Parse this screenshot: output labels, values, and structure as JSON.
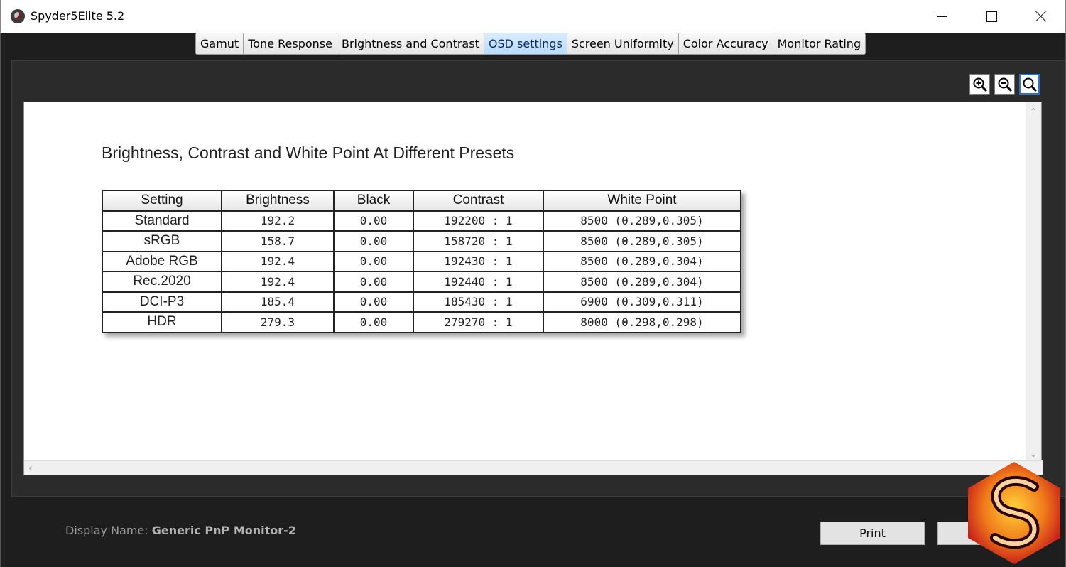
{
  "window": {
    "title": "Spyder5Elite 5.2"
  },
  "tabs": [
    {
      "label": "Gamut"
    },
    {
      "label": "Tone Response"
    },
    {
      "label": "Brightness and Contrast"
    },
    {
      "label": "OSD settings",
      "active": true
    },
    {
      "label": "Screen Uniformity"
    },
    {
      "label": "Color Accuracy"
    },
    {
      "label": "Monitor Rating"
    }
  ],
  "zoom": {
    "icons": [
      "zoom-in-icon",
      "zoom-out-icon",
      "zoom-fit-icon"
    ]
  },
  "report": {
    "title": "Brightness, Contrast and White Point At Different Presets",
    "table": {
      "headers": [
        "Setting",
        "Brightness",
        "Black",
        "Contrast",
        "White Point"
      ],
      "rows": [
        [
          "Standard",
          "192.2",
          "0.00",
          "192200 : 1",
          "8500 (0.289,0.305)"
        ],
        [
          "sRGB",
          "158.7",
          "0.00",
          "158720 : 1",
          "8500 (0.289,0.305)"
        ],
        [
          "Adobe RGB",
          "192.4",
          "0.00",
          "192430 : 1",
          "8500 (0.289,0.304)"
        ],
        [
          "Rec.2020",
          "192.4",
          "0.00",
          "192440 : 1",
          "8500 (0.289,0.304)"
        ],
        [
          "DCI-P3",
          "185.4",
          "0.00",
          "185430 : 1",
          "6900 (0.309,0.311)"
        ],
        [
          "HDR",
          "279.3",
          "0.00",
          "279270 : 1",
          "8000 (0.298,0.298)"
        ]
      ]
    }
  },
  "footer": {
    "display_label": "Display Name:",
    "display_value": "Generic PnP Monitor-2",
    "print_label": "Print"
  },
  "colors": {
    "active_tab": "#b9dbff",
    "background": "#1e1e1e",
    "logo_orange": "#f07a1a",
    "logo_red": "#c0101a"
  }
}
